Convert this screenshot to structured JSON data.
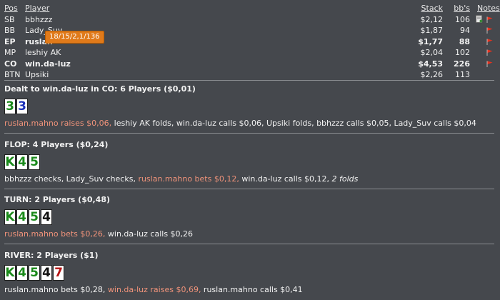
{
  "headers": {
    "pos": "Pos",
    "player": "Player",
    "stack": "Stack",
    "bbs": "bb's",
    "notes": "Notes"
  },
  "players": [
    {
      "pos": "SB",
      "name": "bbhzzz",
      "stack": "$2,12",
      "bbs": "106",
      "bold": false,
      "icons": [
        "note-icon",
        "flag-icon"
      ]
    },
    {
      "pos": "BB",
      "name": "Lady_Suv",
      "stack": "$1,87",
      "bbs": "94",
      "bold": false,
      "icons": [
        "flag-icon"
      ]
    },
    {
      "pos": "EP",
      "name": "ruslan",
      "stack": "$1,77",
      "bbs": "88",
      "bold": true,
      "icons": [
        "flag-icon"
      ]
    },
    {
      "pos": "MP",
      "name": "leshiy AK",
      "stack": "$2,04",
      "bbs": "102",
      "bold": false,
      "icons": [
        "flag-icon"
      ]
    },
    {
      "pos": "CO",
      "name": "win.da-luz",
      "stack": "$4,53",
      "bbs": "226",
      "bold": true,
      "icons": [
        "flag-icon"
      ]
    },
    {
      "pos": "BTN",
      "name": "Upsiki",
      "stack": "$2,26",
      "bbs": "113",
      "bold": false,
      "icons": []
    }
  ],
  "tooltip": "18/15/2,1/136",
  "colors": {
    "background": "#45484d",
    "highlight": "#f0937a",
    "tooltip": "#e07a1a",
    "green_card": "#1a8a1a",
    "blue_card": "#1a2fb8",
    "red_card": "#b51515",
    "black_card": "#111111"
  },
  "streets": [
    {
      "title": "Dealt to win.da-luz in CO: 6 Players ($0,01)",
      "cards": [
        {
          "rank": "3",
          "suit": "green"
        },
        {
          "rank": "3",
          "suit": "blue"
        }
      ],
      "actions": [
        {
          "text": "ruslan.mahno raises $0,06,",
          "style": "hl"
        },
        {
          "text": " leshiy AK folds, win.da-luz calls $0,06, Upsiki folds, bbhzzz calls $0,05, Lady_Suv calls $0,04",
          "style": ""
        }
      ]
    },
    {
      "title": "FLOP: 4 Players ($0,24)",
      "cards": [
        {
          "rank": "K",
          "suit": "green"
        },
        {
          "rank": "4",
          "suit": "green"
        },
        {
          "rank": "5",
          "suit": "green"
        }
      ],
      "actions": [
        {
          "text": "bbhzzz checks, Lady_Suv checks, ",
          "style": ""
        },
        {
          "text": "ruslan.mahno bets $0,12,",
          "style": "hl"
        },
        {
          "text": " win.da-luz calls $0,12, ",
          "style": ""
        },
        {
          "text": "2 folds",
          "style": "it"
        }
      ]
    },
    {
      "title": "TURN: 2 Players ($0,48)",
      "cards": [
        {
          "rank": "K",
          "suit": "green"
        },
        {
          "rank": "4",
          "suit": "green"
        },
        {
          "rank": "5",
          "suit": "green"
        },
        {
          "rank": "4",
          "suit": "black"
        }
      ],
      "actions": [
        {
          "text": "ruslan.mahno bets $0,26,",
          "style": "hl"
        },
        {
          "text": " win.da-luz calls $0,26",
          "style": ""
        }
      ]
    },
    {
      "title": "RIVER: 2 Players ($1)",
      "cards": [
        {
          "rank": "K",
          "suit": "green"
        },
        {
          "rank": "4",
          "suit": "green"
        },
        {
          "rank": "5",
          "suit": "green"
        },
        {
          "rank": "4",
          "suit": "black"
        },
        {
          "rank": "7",
          "suit": "red"
        }
      ],
      "actions": [
        {
          "text": "ruslan.mahno bets $0,28, ",
          "style": ""
        },
        {
          "text": "win.da-luz raises $0,69,",
          "style": "hl"
        },
        {
          "text": " ruslan.mahno calls $0,41",
          "style": ""
        }
      ]
    }
  ]
}
